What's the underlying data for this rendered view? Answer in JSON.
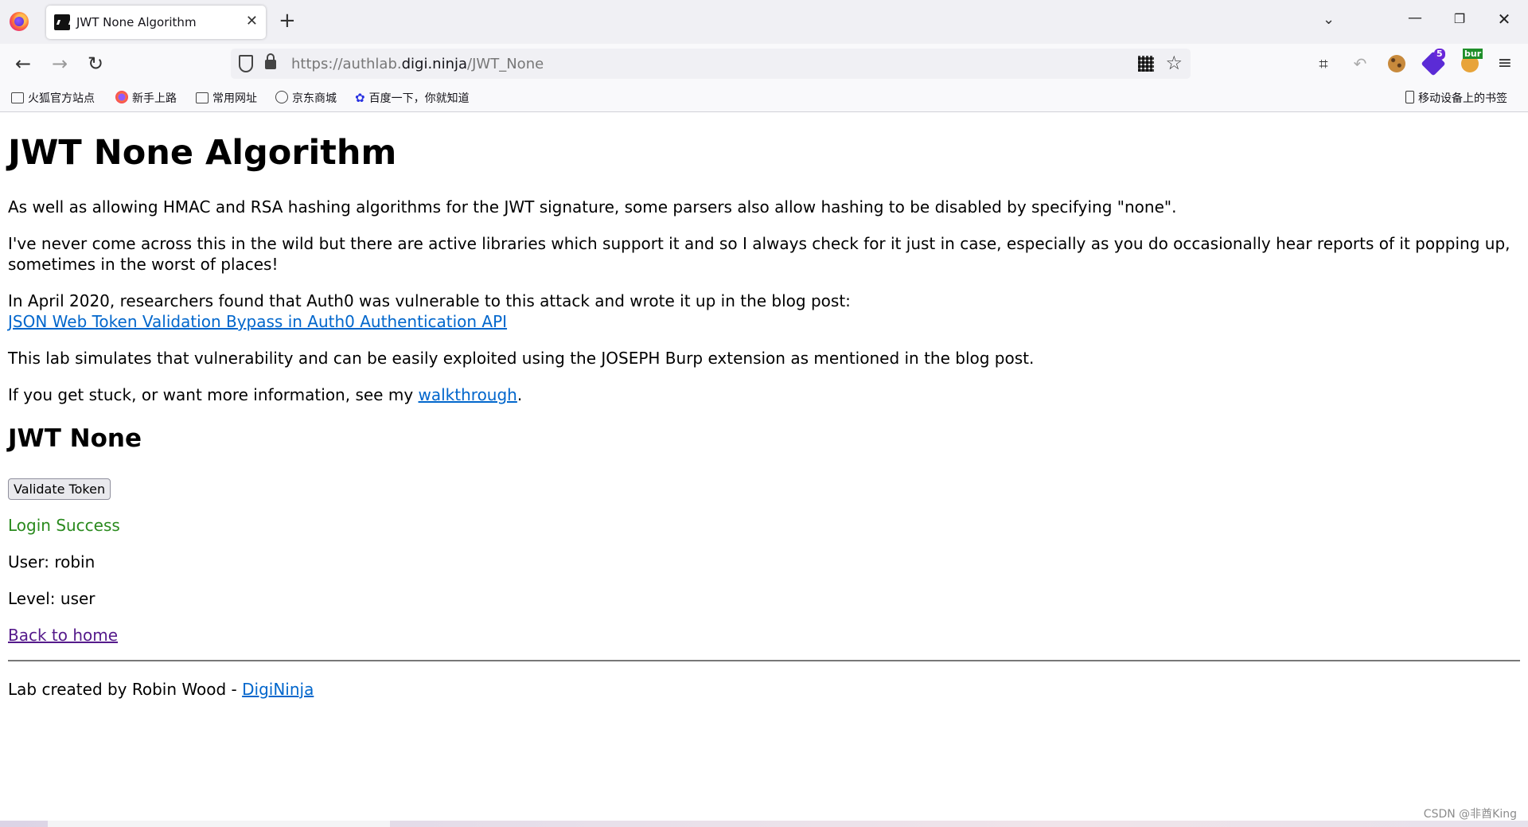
{
  "browser": {
    "tab_title": "JWT None Algorithm",
    "tab_close": "✕",
    "new_tab": "+",
    "url_prefix": "https://authlab.",
    "url_host": "digi.ninja",
    "url_path": "/JWT_None",
    "window": {
      "minimize": "—",
      "restore": "❐",
      "close": "✕"
    },
    "extensions": {
      "hackbar_badge": "5",
      "burp_label": "bur"
    }
  },
  "bookmarks": {
    "items": [
      {
        "label": "火狐官方站点",
        "icon": "folder-icon"
      },
      {
        "label": "新手上路",
        "icon": "firefox-icon"
      },
      {
        "label": "常用网址",
        "icon": "folder-icon"
      },
      {
        "label": "京东商城",
        "icon": "globe-icon"
      },
      {
        "label": "百度一下，你就知道",
        "icon": "baidu-paw-icon"
      }
    ],
    "mobile": "移动设备上的书签"
  },
  "page": {
    "title": "JWT None Algorithm",
    "para1": "As well as allowing HMAC and RSA hashing algorithms for the JWT signature, some parsers also allow hashing to be disabled by specifying \"none\".",
    "para2": "I've never come across this in the wild but there are active libraries which support it and so I always check for it just in case, especially as you do occasionally hear reports of it popping up, sometimes in the worst of places!",
    "para3": "In April 2020, researchers found that Auth0 was vulnerable to this attack and wrote it up in the blog post:",
    "blog_link": "JSON Web Token Validation Bypass in Auth0 Authentication API",
    "para4": "This lab simulates that vulnerability and can be easily exploited using the JOSEPH Burp extension as mentioned in the blog post.",
    "para5_before": "If you get stuck, or want more information, see my ",
    "walkthrough_link": "walkthrough",
    "para5_after": ".",
    "section_title": "JWT None",
    "validate_button": "Validate Token",
    "login_status": "Login Success",
    "user_line": "User: robin",
    "level_line": "Level: user",
    "back_link": "Back to home",
    "footer_text": "Lab created by Robin Wood - ",
    "footer_link": "DigiNinja"
  },
  "watermark": "CSDN @非酋King",
  "colors": {
    "link": "#0066cc",
    "visited_link": "#551a8b",
    "success": "#2a8a1e"
  }
}
